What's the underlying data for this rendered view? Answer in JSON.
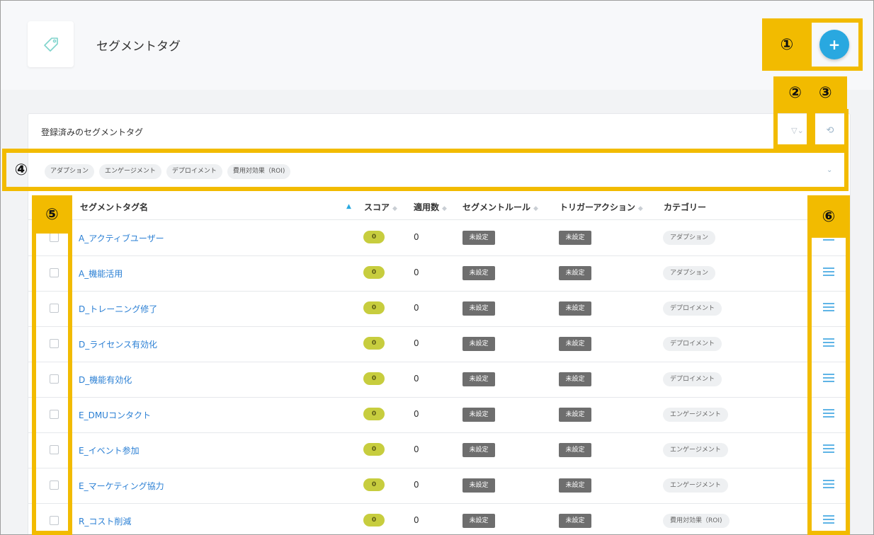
{
  "header": {
    "title": "セグメントタグ",
    "add_label": "+"
  },
  "card": {
    "title": "登録済みのセグメントタグ",
    "filter_label": "▽⌄",
    "reset_label": "⟲"
  },
  "filter_chips": [
    "アダプション",
    "エンゲージメント",
    "デプロイメント",
    "費用対効果（ROI)"
  ],
  "chip_expand": "⌄",
  "table": {
    "columns": [
      "セグメントタグ名",
      "スコア",
      "適用数",
      "セグメントルール",
      "トリガーアクション",
      "カテゴリー"
    ],
    "rows": [
      {
        "name": "A_アクティブユーザー",
        "score": "0",
        "count": "0",
        "rule": "未設定",
        "trigger": "未設定",
        "category": "アダプション"
      },
      {
        "name": "A_機能活用",
        "score": "0",
        "count": "0",
        "rule": "未設定",
        "trigger": "未設定",
        "category": "アダプション"
      },
      {
        "name": "D_トレーニング修了",
        "score": "0",
        "count": "0",
        "rule": "未設定",
        "trigger": "未設定",
        "category": "デプロイメント"
      },
      {
        "name": "D_ライセンス有効化",
        "score": "0",
        "count": "0",
        "rule": "未設定",
        "trigger": "未設定",
        "category": "デプロイメント"
      },
      {
        "name": "D_機能有効化",
        "score": "0",
        "count": "0",
        "rule": "未設定",
        "trigger": "未設定",
        "category": "デプロイメント"
      },
      {
        "name": "E_DMUコンタクト",
        "score": "0",
        "count": "0",
        "rule": "未設定",
        "trigger": "未設定",
        "category": "エンゲージメント"
      },
      {
        "name": "E_イベント参加",
        "score": "0",
        "count": "0",
        "rule": "未設定",
        "trigger": "未設定",
        "category": "エンゲージメント"
      },
      {
        "name": "E_マーケティング協力",
        "score": "0",
        "count": "0",
        "rule": "未設定",
        "trigger": "未設定",
        "category": "エンゲージメント"
      },
      {
        "name": "R_コスト削減",
        "score": "0",
        "count": "0",
        "rule": "未設定",
        "trigger": "未設定",
        "category": "費用対効果（ROI)"
      }
    ]
  },
  "annotations": {
    "a1": "①",
    "a2": "②",
    "a3": "③",
    "a4": "④",
    "a5": "⑤",
    "a6": "⑥"
  },
  "colors": {
    "accent": "#29a8e0",
    "highlight": "#f2bb00",
    "score": "#c7cd3e",
    "unset": "#6e6e6e",
    "link": "#2a7fd4"
  },
  "icons": {
    "tag": "tag-icon",
    "add": "plus-icon",
    "filter": "filter-icon",
    "reset": "history-icon",
    "menu": "menu-icon",
    "sort": "sort-icon"
  }
}
